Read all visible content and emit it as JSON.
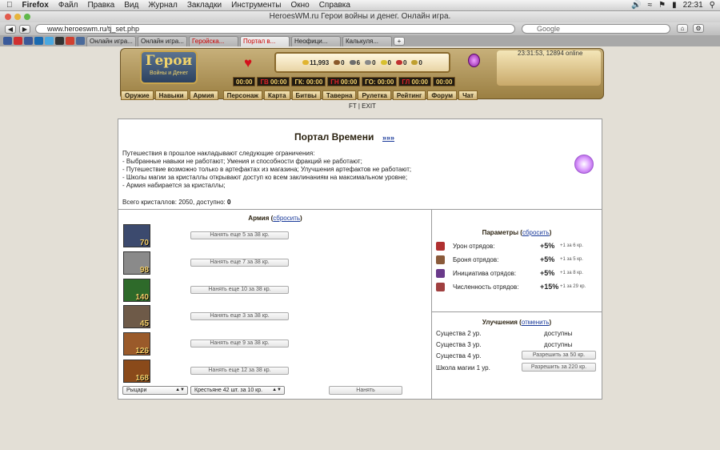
{
  "os_menubar": {
    "app": "Firefox",
    "items": [
      "Файл",
      "Правка",
      "Вид",
      "Журнал",
      "Закладки",
      "Инструменты",
      "Окно",
      "Справка"
    ],
    "clock": "22:31"
  },
  "window": {
    "title": "HeroesWM.ru Герои войны и денег. Онлайн игра."
  },
  "browser": {
    "url": "www.heroeswm.ru/tj_set.php",
    "search_placeholder": "Google",
    "bookmark_icons": [
      "youtube",
      "facebook",
      "linkedin",
      "twitter",
      "hh",
      "gmail",
      "vk"
    ],
    "tabs": [
      {
        "label": "Онлайн игра..."
      },
      {
        "label": "Онлайн игра..."
      },
      {
        "label": "Геройска..."
      },
      {
        "label": "Портал в..."
      },
      {
        "label": "Неофици..."
      },
      {
        "label": "Калькуля..."
      }
    ],
    "new_tab": "+"
  },
  "game": {
    "logo_title": "Герои",
    "logo_subtitle": "Войны и Денег",
    "server_time": "23:31:53, 12894 online",
    "resources": [
      {
        "value": "11,993",
        "color": "#e0b430"
      },
      {
        "value": "0",
        "color": "#8b5a2b"
      },
      {
        "value": "6",
        "color": "#6e6e6e"
      },
      {
        "value": "0",
        "color": "#8a8a8a"
      },
      {
        "value": "0",
        "color": "#d8c030"
      },
      {
        "value": "0",
        "color": "#c03030"
      },
      {
        "value": "0",
        "color": "#c0a030"
      }
    ],
    "timers": [
      {
        "prefix": "",
        "value": "00:00"
      },
      {
        "prefix": "ГВ",
        "value": "00:00"
      },
      {
        "prefix": "ГК:",
        "value": "00:00"
      },
      {
        "prefix": "ГН",
        "value": "00:00"
      },
      {
        "prefix": "ГО:",
        "value": "00:00"
      },
      {
        "prefix": "ГЛ",
        "value": "00:00"
      },
      {
        "prefix": "",
        "value": "00:00"
      }
    ],
    "nav": [
      "Оружие",
      "Навыки",
      "Армия",
      "Персонаж",
      "Карта",
      "Битвы",
      "Таверна",
      "Рулетка",
      "Рейтинг",
      "Форум",
      "Чат"
    ],
    "ft_exit": "FT | EXIT"
  },
  "portal": {
    "title": "Портал Времени",
    "link": "»»»",
    "lines": [
      "Путешествия в прошлое накладывают следующие ограничения:",
      "- Выбранные навыки не работают; Умения и способности фракций не работают;",
      "- Путешествие возможно только в артефактах из магазина; Улучшения артефактов не работают;",
      "- Школы магии за кристаллы открывают доступ ко всем заклинаниям на максимальном уровне;",
      "- Армия набирается за кристаллы;"
    ],
    "crystals_label": "Всего кристаллов: 2050, доступно:",
    "crystals_available": "0"
  },
  "army": {
    "title": "Армия",
    "reset": "сбросить",
    "units": [
      {
        "count": "70",
        "hire": "Нанять еще 5 за 38 кр.",
        "color": "#3c4a6e"
      },
      {
        "count": "98",
        "hire": "Нанять еще 7 за 38 кр.",
        "color": "#8a8a8a"
      },
      {
        "count": "140",
        "hire": "Нанять еще 10 за 38 кр.",
        "color": "#2e6a2a"
      },
      {
        "count": "45",
        "hire": "Нанять еще 3 за 38 кр.",
        "color": "#6e5a48"
      },
      {
        "count": "126",
        "hire": "Нанять еще 9 за 38 кр.",
        "color": "#9a5a2a"
      },
      {
        "count": "168",
        "hire": "Нанять еще 12 за 38 кр.",
        "color": "#8a4a1a"
      }
    ],
    "faction_select": "Рыцари",
    "unit_select": "Крестьяне 42 шт. за 10 кр.",
    "hire_button": "Нанять"
  },
  "params": {
    "title": "Параметры",
    "reset": "сбросить",
    "rows": [
      {
        "label": "Урон отрядов:",
        "value": "+5%",
        "note": "+1 за 6 кр.",
        "color": "#b03030"
      },
      {
        "label": "Броня отрядов:",
        "value": "+5%",
        "note": "+1 за 5 кр.",
        "color": "#8a5a3a"
      },
      {
        "label": "Инициатива отрядов:",
        "value": "+5%",
        "note": "+1 за 8 кр.",
        "color": "#6a3a8a"
      },
      {
        "label": "Численность отрядов:",
        "value": "+15%",
        "note": "+1 за 29 кр.",
        "color": "#a04040"
      }
    ]
  },
  "upgrades": {
    "title": "Улучшения",
    "cancel": "отменить",
    "rows": [
      {
        "label": "Существа 2 ур.",
        "status": "доступны",
        "button": ""
      },
      {
        "label": "Существа 3 ур.",
        "status": "доступны",
        "button": ""
      },
      {
        "label": "Существа 4 ур.",
        "status": "",
        "button": "Разрешить за 50 кр."
      },
      {
        "label": "Школа магии 1 ур.",
        "status": "",
        "button": "Разрешить за 220 кр."
      }
    ]
  }
}
